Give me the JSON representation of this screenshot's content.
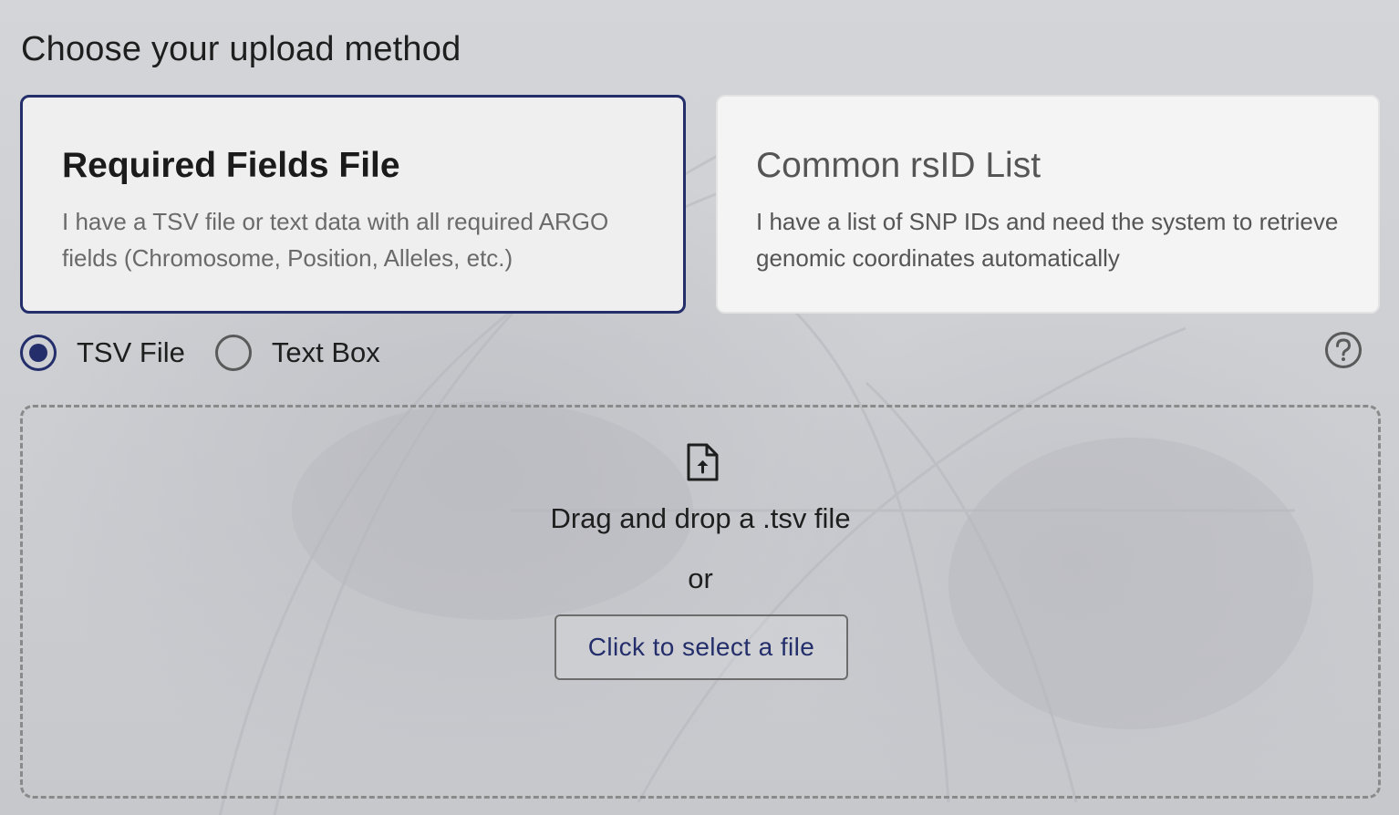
{
  "heading": "Choose your upload method",
  "cards": [
    {
      "title": "Required Fields File",
      "description": "I have a TSV file or text data with all required ARGO fields (Chromosome, Position, Alleles, etc.)",
      "selected": true
    },
    {
      "title": "Common rsID List",
      "description": "I have a list of SNP IDs and need the system to retrieve genomic coordinates automatically",
      "selected": false
    }
  ],
  "input_mode": {
    "options": [
      {
        "label": "TSV File",
        "checked": true
      },
      {
        "label": "Text Box",
        "checked": false
      }
    ],
    "help_icon": "question-circle-icon"
  },
  "dropzone": {
    "icon": "file-upload-icon",
    "drag_text": "Drag and drop a .tsv file",
    "or_text": "or",
    "button_label": "Click to select a file"
  },
  "colors": {
    "accent": "#232e6b",
    "dashed_border": "#8a8a8a",
    "muted_text": "#6a6a6a"
  }
}
